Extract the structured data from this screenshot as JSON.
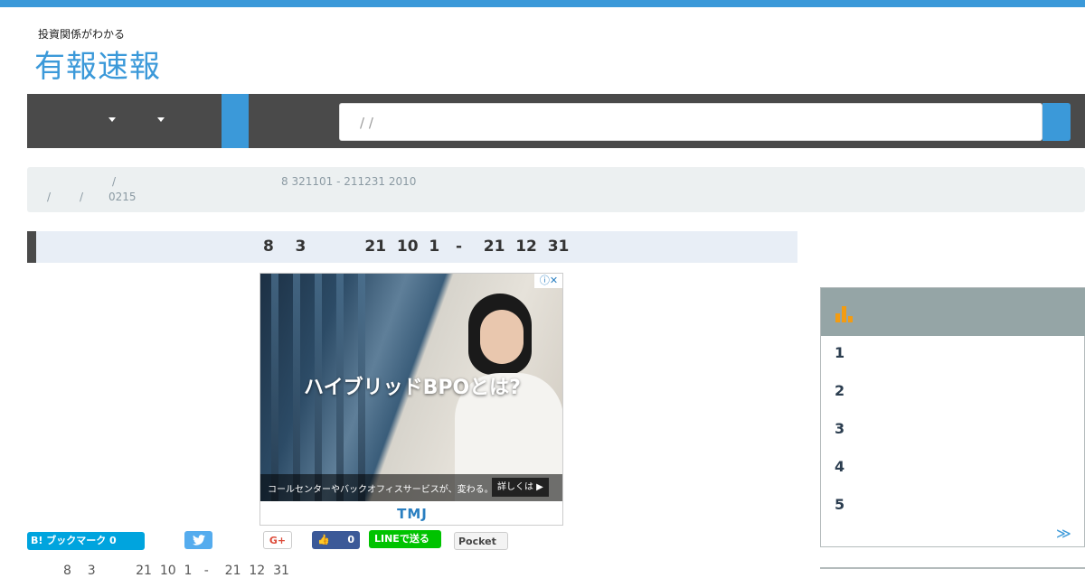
{
  "header": {
    "tagline": "投資関係がわかる",
    "logo": "有報速報",
    "accent_color": "#3b99d9"
  },
  "search": {
    "value": "/ /"
  },
  "breadcrumb": {
    "sep_a": "/",
    "title": "8 321101 - 211231 2010",
    "sep_b": "/",
    "sep_c": "/",
    "code": "0215"
  },
  "page": {
    "heading": "8    3           21  10  1   -    21  12  31"
  },
  "ad": {
    "headline": "ハイブリッドBPOとは?",
    "subtext": "コールセンターやバックオフィスサービスが、変わる。",
    "cta": "詳しくは ▶",
    "brand": "TMJ"
  },
  "share": {
    "hatena": "B! ブックマーク 0",
    "twitter_icon": "twitter-icon",
    "gplus": "G+",
    "fb_count": "0",
    "line": "LINEで送る",
    "pocket": "Pocket"
  },
  "next_line": "8    3          21  10  1   -    21  12  31",
  "ranking": {
    "icon": "bar-chart-icon",
    "icon_color": "#f39c12",
    "items": [
      "1",
      "2",
      "3",
      "4",
      "5"
    ],
    "more": "≫"
  }
}
